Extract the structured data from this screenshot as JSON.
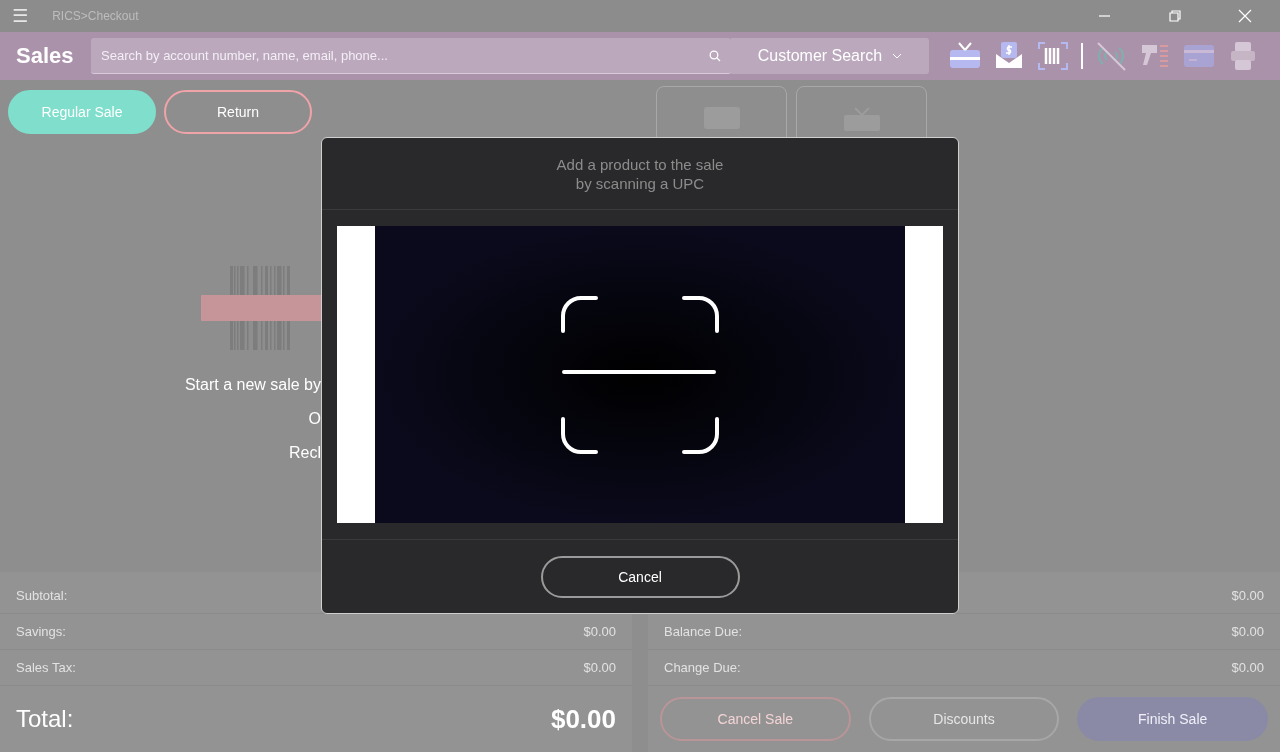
{
  "title_bar": {
    "menu": "☰",
    "title": "RICS>Checkout"
  },
  "header": {
    "title": "Sales",
    "search": {
      "placeholder": "Search by account number, name, email, phone..."
    },
    "customer_search": "Customer Search"
  },
  "sale_types": [
    {
      "label": "Regular Sale",
      "selected": true
    },
    {
      "label": "Return",
      "selected": false
    }
  ],
  "empty_state": {
    "lines": [
      "Start a new sale by",
      "O",
      "Recl"
    ]
  },
  "summary_left": [
    {
      "label": "Subtotal:"
    },
    {
      "label": "Savings:",
      "value": "$0.00"
    },
    {
      "label": "Sales Tax:",
      "value": "$0.00"
    }
  ],
  "total": {
    "label": "Total:",
    "value": "$0.00"
  },
  "summary_right": [
    {
      "value": "$0.00"
    },
    {
      "label": "Balance Due:",
      "value": "$0.00"
    },
    {
      "label": "Change Due:",
      "value": "$0.00"
    }
  ],
  "actions": [
    {
      "label": "Cancel Sale",
      "kind": "danger"
    },
    {
      "label": "Discounts",
      "kind": "outline"
    },
    {
      "label": "Finish Sale",
      "kind": "primary"
    }
  ],
  "dialog": {
    "prompt": [
      "Add a product to the sale",
      "by scanning a UPC"
    ],
    "cancel": "Cancel"
  }
}
